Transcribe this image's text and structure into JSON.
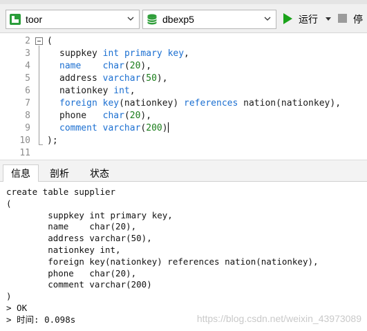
{
  "toolbar": {
    "connection": {
      "value": "toor",
      "icon": "connection-icon"
    },
    "database": {
      "value": "dbexp5",
      "icon": "database-icon"
    },
    "run_label": "运行",
    "stop_label": "停",
    "colors": {
      "run": "#1aa31a",
      "connection_icon": "#2a9d3a",
      "database_icon": "#2f9e3a"
    }
  },
  "editor": {
    "lines": [
      {
        "n": "2",
        "segments": [
          {
            "t": "(",
            "c": "plain"
          }
        ]
      },
      {
        "n": "3",
        "segments": [
          {
            "t": "suppkey ",
            "c": "plain"
          },
          {
            "t": "int",
            "c": "kw"
          },
          {
            "t": " ",
            "c": "plain"
          },
          {
            "t": "primary",
            "c": "kw"
          },
          {
            "t": " ",
            "c": "plain"
          },
          {
            "t": "key",
            "c": "kw"
          },
          {
            "t": ",",
            "c": "plain"
          }
        ]
      },
      {
        "n": "4",
        "segments": [
          {
            "t": "name",
            "c": "kw"
          },
          {
            "t": "    ",
            "c": "plain"
          },
          {
            "t": "char",
            "c": "kw"
          },
          {
            "t": "(",
            "c": "plain"
          },
          {
            "t": "20",
            "c": "num"
          },
          {
            "t": "),",
            "c": "plain"
          }
        ]
      },
      {
        "n": "5",
        "segments": [
          {
            "t": "address ",
            "c": "plain"
          },
          {
            "t": "varchar",
            "c": "kw"
          },
          {
            "t": "(",
            "c": "plain"
          },
          {
            "t": "50",
            "c": "num"
          },
          {
            "t": "),",
            "c": "plain"
          }
        ]
      },
      {
        "n": "6",
        "segments": [
          {
            "t": "nationkey ",
            "c": "plain"
          },
          {
            "t": "int",
            "c": "kw"
          },
          {
            "t": ",",
            "c": "plain"
          }
        ]
      },
      {
        "n": "7",
        "segments": [
          {
            "t": "foreign",
            "c": "kw"
          },
          {
            "t": " ",
            "c": "plain"
          },
          {
            "t": "key",
            "c": "kw"
          },
          {
            "t": "(nationkey) ",
            "c": "plain"
          },
          {
            "t": "references",
            "c": "kw"
          },
          {
            "t": " nation(nationkey),",
            "c": "plain"
          }
        ]
      },
      {
        "n": "8",
        "segments": [
          {
            "t": "phone   ",
            "c": "plain"
          },
          {
            "t": "char",
            "c": "kw"
          },
          {
            "t": "(",
            "c": "plain"
          },
          {
            "t": "20",
            "c": "num"
          },
          {
            "t": "),",
            "c": "plain"
          }
        ]
      },
      {
        "n": "9",
        "segments": [
          {
            "t": "comment",
            "c": "kw"
          },
          {
            "t": " ",
            "c": "plain"
          },
          {
            "t": "varchar",
            "c": "kw"
          },
          {
            "t": "(",
            "c": "plain"
          },
          {
            "t": "200",
            "c": "num"
          },
          {
            "t": ")",
            "c": "plain"
          }
        ]
      },
      {
        "n": "10",
        "segments": [
          {
            "t": ");",
            "c": "plain"
          }
        ]
      },
      {
        "n": "11",
        "segments": []
      }
    ],
    "colors": {
      "keyword": "#1b6fd1",
      "number": "#1a7d1a",
      "plain": "#1a1a1a",
      "line_number": "#8c8c8c"
    }
  },
  "tabs": [
    {
      "label": "信息",
      "active": true
    },
    {
      "label": "剖析",
      "active": false
    },
    {
      "label": "状态",
      "active": false
    }
  ],
  "output": {
    "lines": [
      "create table supplier",
      "(",
      "        suppkey int primary key,",
      "        name    char(20),",
      "        address varchar(50),",
      "        nationkey int,",
      "        foreign key(nationkey) references nation(nationkey),",
      "        phone   char(20),",
      "        comment varchar(200)",
      ")",
      "> OK",
      "> 时间: 0.098s"
    ],
    "watermark": "https://blog.csdn.net/weixin_43973089"
  }
}
